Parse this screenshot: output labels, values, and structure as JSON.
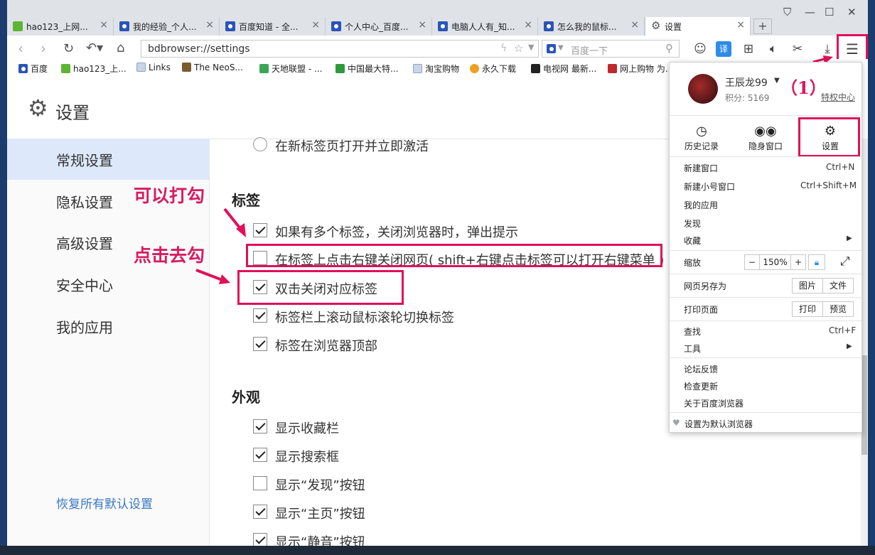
{
  "tabs": [
    {
      "label": "hao123_上网...",
      "icon": "hao123-icon"
    },
    {
      "label": "我的经验_个人...",
      "icon": "baidu-paw-icon"
    },
    {
      "label": "百度知道 - 全...",
      "icon": "baidu-paw-icon"
    },
    {
      "label": "个人中心_百度...",
      "icon": "baidu-paw-icon"
    },
    {
      "label": "电脑人人有_知...",
      "icon": "baidu-paw-icon"
    },
    {
      "label": "怎么我的鼠标...",
      "icon": "baidu-paw-icon"
    },
    {
      "label": "设置",
      "icon": "gear-icon"
    }
  ],
  "address": {
    "url": "bdbrowser://settings"
  },
  "search": {
    "placeholder": "百度一下"
  },
  "bookmarks": [
    "百度",
    "hao123_上...",
    "Links",
    "The NeoS...",
    "天地联盟 - ...",
    "中国最大特...",
    "淘宝购物",
    "永久下载",
    "电视网 最新...",
    "网上购物 为..."
  ],
  "page": {
    "title": "设置"
  },
  "sidebar": {
    "items": [
      "常规设置",
      "隐私设置",
      "高级设置",
      "安全中心",
      "我的应用"
    ],
    "restore": "恢复所有默认设置"
  },
  "content": {
    "top_radio": "在新标签页打开并立即激活",
    "tabs_section": "标签",
    "tab_options": [
      {
        "label": "如果有多个标签，关闭浏览器时，弹出提示",
        "checked": true
      },
      {
        "label": "在标签上点击右键关闭网页( shift+右键点击标签可以打开右键菜单 )",
        "checked": false
      },
      {
        "label": "双击关闭对应标签",
        "checked": true
      },
      {
        "label": "标签栏上滚动鼠标滚轮切换标签",
        "checked": true
      },
      {
        "label": "标签在浏览器顶部",
        "checked": true
      }
    ],
    "appearance_section": "外观",
    "appearance_options": [
      {
        "label": "显示收藏栏",
        "checked": true
      },
      {
        "label": "显示搜索框",
        "checked": true
      },
      {
        "label": "显示“发现”按钮",
        "checked": false
      },
      {
        "label": "显示“主页”按钮",
        "checked": true
      },
      {
        "label": "显示“静音”按钮",
        "checked": true
      }
    ]
  },
  "annotations": {
    "check_hint": "可以打勾",
    "uncheck_hint": "点击去勾",
    "step": "（1）"
  },
  "menu": {
    "user": "王辰龙99",
    "points": "积分: 5169",
    "privilege": "特权中心",
    "quick": [
      "历史记录",
      "隐身窗口",
      "设置"
    ],
    "new_window": "新建窗口",
    "new_window_key": "Ctrl+N",
    "new_small": "新建小号窗口",
    "new_small_key": "Ctrl+Shift+M",
    "my_apps": "我的应用",
    "discover": "发现",
    "favorites": "收藏",
    "zoom": "缩放",
    "zoom_minus": "−",
    "zoom_value": "150%",
    "zoom_plus": "+",
    "save_as": "网页另存为",
    "save_image": "图片",
    "save_file": "文件",
    "print": "打印页面",
    "print_btn": "打印",
    "preview_btn": "预览",
    "find": "查找",
    "find_key": "Ctrl+F",
    "tools": "工具",
    "feedback": "论坛反馈",
    "update": "检查更新",
    "about": "关于百度浏览器",
    "default": "设置为默认浏览器"
  },
  "colors": {
    "annotation": "#e0105a",
    "link": "#3a78c2",
    "active_side": "#dde9fb"
  }
}
